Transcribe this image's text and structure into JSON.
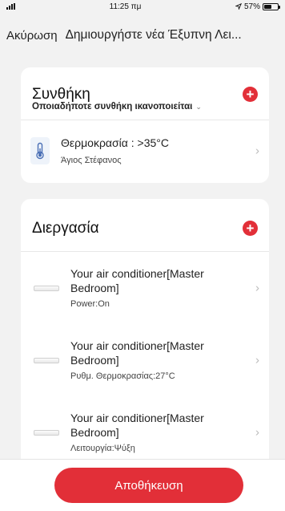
{
  "status_bar": {
    "time": "11:25 πμ",
    "battery": "57%",
    "battery_level": 0.57
  },
  "header": {
    "cancel_label": "Ακύρωση",
    "title": "Δημιουργήστε νέα Έξυπνη Λει..."
  },
  "condition": {
    "title": "Συνθήκη",
    "subtitle": "Οποιαδήποτε συνθήκη ικανοποιείται",
    "items": [
      {
        "icon": "thermometer-icon",
        "label": "Θερμοκρασία : >35°C",
        "location": "Άγιος Στέφανος"
      }
    ]
  },
  "process": {
    "title": "Διεργασία",
    "items": [
      {
        "icon": "air-conditioner-icon",
        "device": "Your air conditioner[Master Bedroom]",
        "action": "Power:On"
      },
      {
        "icon": "air-conditioner-icon",
        "device": "Your air conditioner[Master Bedroom]",
        "action": "Ρυθμ. Θερμοκρασίας:27°C"
      },
      {
        "icon": "air-conditioner-icon",
        "device": "Your air conditioner[Master Bedroom]",
        "action": "Λειτουργία:Ψύξη"
      }
    ]
  },
  "footer": {
    "save_label": "Αποθήκευση"
  },
  "colors": {
    "accent": "#e22f38",
    "background": "#f2f2f2",
    "card": "#ffffff",
    "thermometer": "#4a6fb5"
  }
}
